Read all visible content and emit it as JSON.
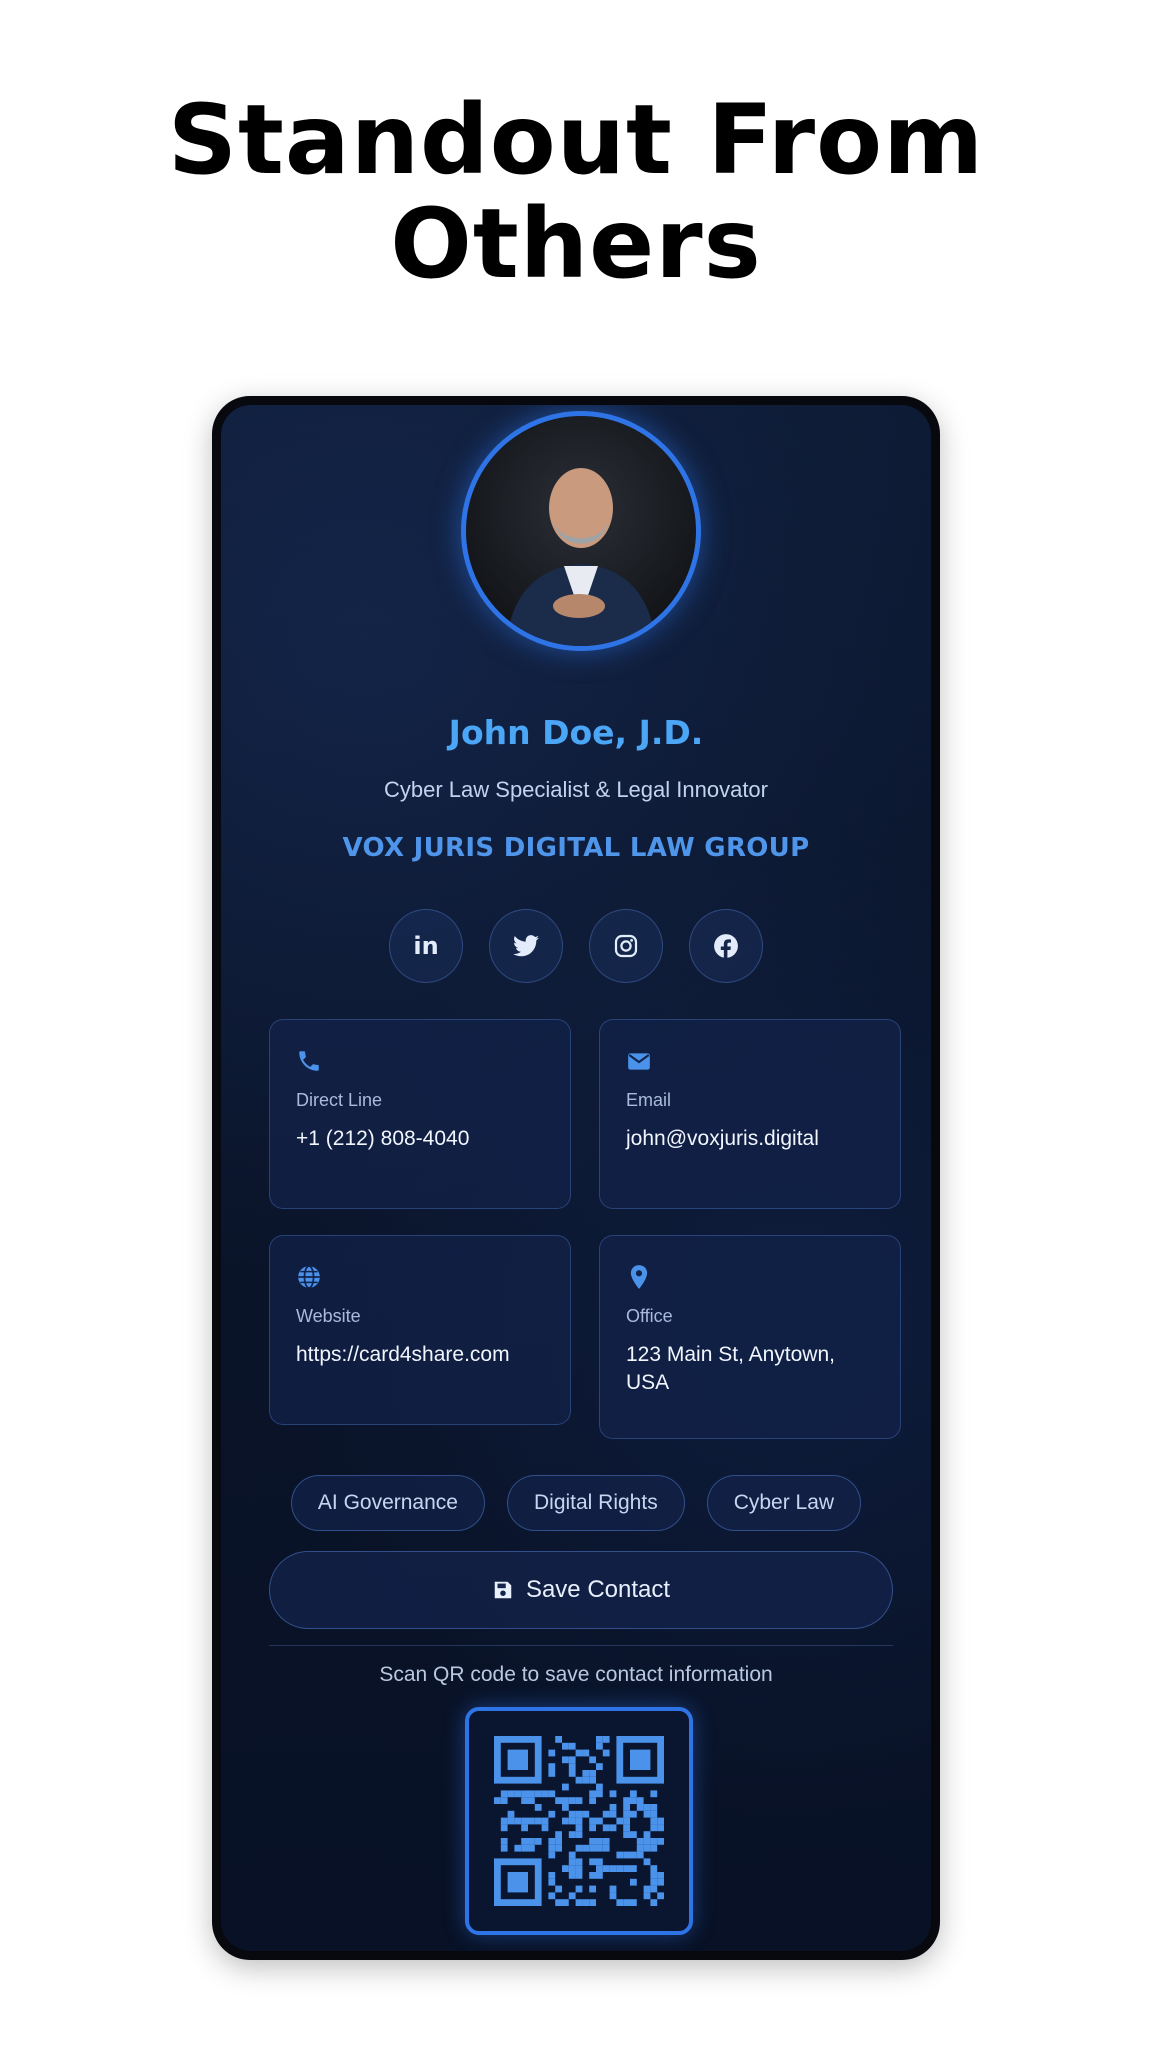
{
  "headline": {
    "line1": "Standout From",
    "line2": "Others"
  },
  "profile": {
    "name": "John Doe, J.D.",
    "title": "Cyber Law Specialist & Legal Innovator",
    "company": "VOX JURIS DIGITAL LAW GROUP",
    "avatar_icon": "profile-photo"
  },
  "socials": [
    {
      "icon": "linkedin-icon"
    },
    {
      "icon": "twitter-icon"
    },
    {
      "icon": "instagram-icon"
    },
    {
      "icon": "facebook-icon"
    }
  ],
  "contacts": {
    "phone": {
      "label": "Direct Line",
      "value": "+1 (212) 808-4040",
      "icon": "phone-icon"
    },
    "email": {
      "label": "Email",
      "value": "john@voxjuris.digital",
      "icon": "envelope-icon"
    },
    "website": {
      "label": "Website",
      "value": "https://card4share.com",
      "icon": "globe-icon"
    },
    "office": {
      "label": "Office",
      "value": "123 Main St, Anytown, USA",
      "icon": "location-pin-icon"
    }
  },
  "tags": [
    "AI Governance",
    "Digital Rights",
    "Cyber Law"
  ],
  "save_button": {
    "label": "Save Contact",
    "icon": "floppy-disk-icon"
  },
  "qr": {
    "caption": "Scan QR code to save contact information",
    "icon": "qr-code"
  },
  "colors": {
    "accent": "#2e74e6",
    "name": "#4ba6f5",
    "company": "#4f95ea",
    "background": "#0a1429"
  }
}
